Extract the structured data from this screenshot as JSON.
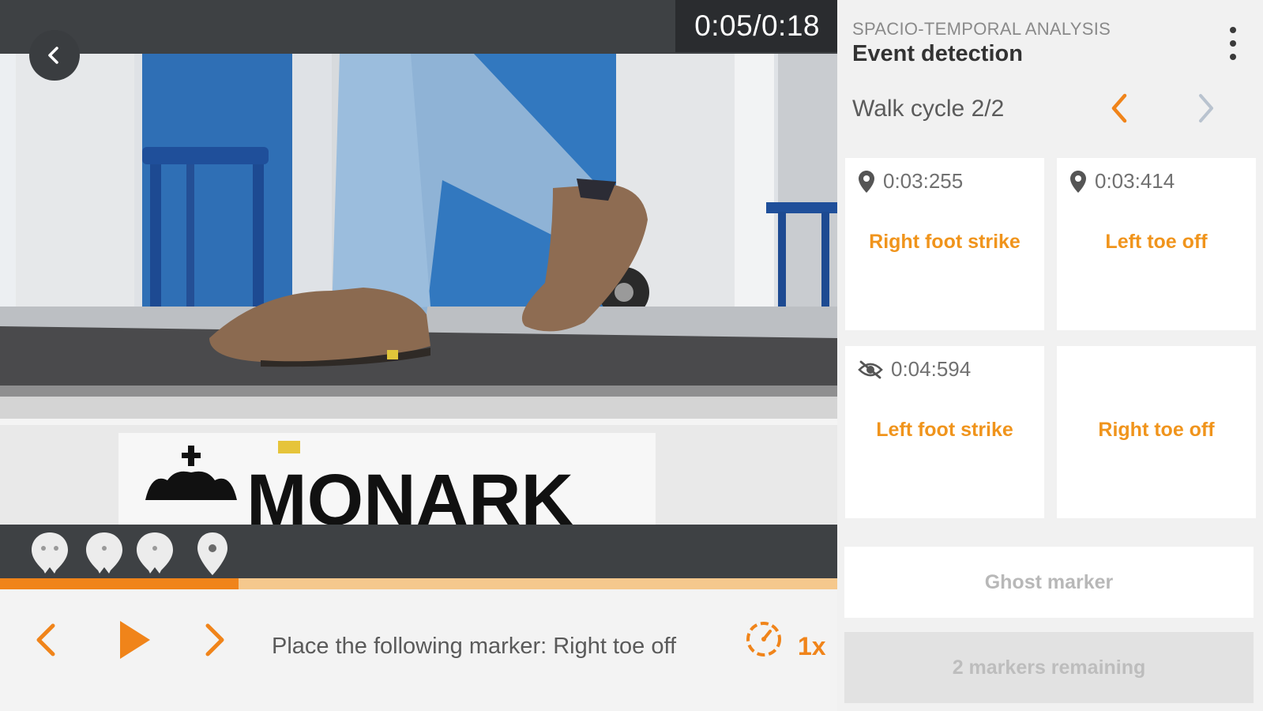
{
  "player": {
    "timecode": "0:05/0:18",
    "progress": 0.285,
    "instruction": "Place the following marker: Right toe off",
    "speed": "1x",
    "colors": {
      "accent": "#f0841a",
      "track": "#f5c88d",
      "bar": "#3e4144"
    },
    "markers": [
      {
        "icon": "ghost-marker-icon"
      },
      {
        "icon": "ghost-marker-icon"
      },
      {
        "icon": "ghost-marker-icon"
      },
      {
        "icon": "location-pin-icon"
      }
    ],
    "video": {
      "brand_text": "MONARK"
    }
  },
  "panel": {
    "kicker": "SPACIO-TEMPORAL ANALYSIS",
    "title": "Event detection",
    "walk_cycle": "Walk cycle 2/2",
    "events": [
      {
        "time": "0:03:255",
        "name": "Right foot strike",
        "icon": "location-pin-icon"
      },
      {
        "time": "0:03:414",
        "name": "Left toe off",
        "icon": "location-pin-icon"
      },
      {
        "time": "0:04:594",
        "name": "Left foot strike",
        "icon": "eye-off-icon"
      },
      {
        "time": "",
        "name": "Right toe off",
        "icon": ""
      }
    ],
    "ghost_label": "Ghost marker",
    "remaining_label": "2 markers remaining"
  }
}
